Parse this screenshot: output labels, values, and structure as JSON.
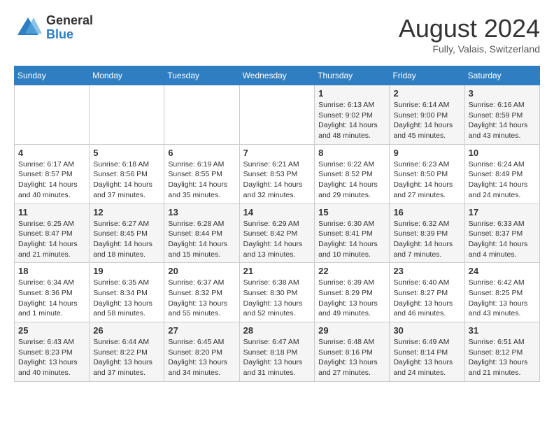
{
  "logo": {
    "general": "General",
    "blue": "Blue"
  },
  "title": "August 2024",
  "location": "Fully, Valais, Switzerland",
  "weekdays": [
    "Sunday",
    "Monday",
    "Tuesday",
    "Wednesday",
    "Thursday",
    "Friday",
    "Saturday"
  ],
  "weeks": [
    [
      {
        "day": "",
        "info": ""
      },
      {
        "day": "",
        "info": ""
      },
      {
        "day": "",
        "info": ""
      },
      {
        "day": "",
        "info": ""
      },
      {
        "day": "1",
        "info": "Sunrise: 6:13 AM\nSunset: 9:02 PM\nDaylight: 14 hours and 48 minutes."
      },
      {
        "day": "2",
        "info": "Sunrise: 6:14 AM\nSunset: 9:00 PM\nDaylight: 14 hours and 45 minutes."
      },
      {
        "day": "3",
        "info": "Sunrise: 6:16 AM\nSunset: 8:59 PM\nDaylight: 14 hours and 43 minutes."
      }
    ],
    [
      {
        "day": "4",
        "info": "Sunrise: 6:17 AM\nSunset: 8:57 PM\nDaylight: 14 hours and 40 minutes."
      },
      {
        "day": "5",
        "info": "Sunrise: 6:18 AM\nSunset: 8:56 PM\nDaylight: 14 hours and 37 minutes."
      },
      {
        "day": "6",
        "info": "Sunrise: 6:19 AM\nSunset: 8:55 PM\nDaylight: 14 hours and 35 minutes."
      },
      {
        "day": "7",
        "info": "Sunrise: 6:21 AM\nSunset: 8:53 PM\nDaylight: 14 hours and 32 minutes."
      },
      {
        "day": "8",
        "info": "Sunrise: 6:22 AM\nSunset: 8:52 PM\nDaylight: 14 hours and 29 minutes."
      },
      {
        "day": "9",
        "info": "Sunrise: 6:23 AM\nSunset: 8:50 PM\nDaylight: 14 hours and 27 minutes."
      },
      {
        "day": "10",
        "info": "Sunrise: 6:24 AM\nSunset: 8:49 PM\nDaylight: 14 hours and 24 minutes."
      }
    ],
    [
      {
        "day": "11",
        "info": "Sunrise: 6:25 AM\nSunset: 8:47 PM\nDaylight: 14 hours and 21 minutes."
      },
      {
        "day": "12",
        "info": "Sunrise: 6:27 AM\nSunset: 8:45 PM\nDaylight: 14 hours and 18 minutes."
      },
      {
        "day": "13",
        "info": "Sunrise: 6:28 AM\nSunset: 8:44 PM\nDaylight: 14 hours and 15 minutes."
      },
      {
        "day": "14",
        "info": "Sunrise: 6:29 AM\nSunset: 8:42 PM\nDaylight: 14 hours and 13 minutes."
      },
      {
        "day": "15",
        "info": "Sunrise: 6:30 AM\nSunset: 8:41 PM\nDaylight: 14 hours and 10 minutes."
      },
      {
        "day": "16",
        "info": "Sunrise: 6:32 AM\nSunset: 8:39 PM\nDaylight: 14 hours and 7 minutes."
      },
      {
        "day": "17",
        "info": "Sunrise: 6:33 AM\nSunset: 8:37 PM\nDaylight: 14 hours and 4 minutes."
      }
    ],
    [
      {
        "day": "18",
        "info": "Sunrise: 6:34 AM\nSunset: 8:36 PM\nDaylight: 14 hours and 1 minute."
      },
      {
        "day": "19",
        "info": "Sunrise: 6:35 AM\nSunset: 8:34 PM\nDaylight: 13 hours and 58 minutes."
      },
      {
        "day": "20",
        "info": "Sunrise: 6:37 AM\nSunset: 8:32 PM\nDaylight: 13 hours and 55 minutes."
      },
      {
        "day": "21",
        "info": "Sunrise: 6:38 AM\nSunset: 8:30 PM\nDaylight: 13 hours and 52 minutes."
      },
      {
        "day": "22",
        "info": "Sunrise: 6:39 AM\nSunset: 8:29 PM\nDaylight: 13 hours and 49 minutes."
      },
      {
        "day": "23",
        "info": "Sunrise: 6:40 AM\nSunset: 8:27 PM\nDaylight: 13 hours and 46 minutes."
      },
      {
        "day": "24",
        "info": "Sunrise: 6:42 AM\nSunset: 8:25 PM\nDaylight: 13 hours and 43 minutes."
      }
    ],
    [
      {
        "day": "25",
        "info": "Sunrise: 6:43 AM\nSunset: 8:23 PM\nDaylight: 13 hours and 40 minutes."
      },
      {
        "day": "26",
        "info": "Sunrise: 6:44 AM\nSunset: 8:22 PM\nDaylight: 13 hours and 37 minutes."
      },
      {
        "day": "27",
        "info": "Sunrise: 6:45 AM\nSunset: 8:20 PM\nDaylight: 13 hours and 34 minutes."
      },
      {
        "day": "28",
        "info": "Sunrise: 6:47 AM\nSunset: 8:18 PM\nDaylight: 13 hours and 31 minutes."
      },
      {
        "day": "29",
        "info": "Sunrise: 6:48 AM\nSunset: 8:16 PM\nDaylight: 13 hours and 27 minutes."
      },
      {
        "day": "30",
        "info": "Sunrise: 6:49 AM\nSunset: 8:14 PM\nDaylight: 13 hours and 24 minutes."
      },
      {
        "day": "31",
        "info": "Sunrise: 6:51 AM\nSunset: 8:12 PM\nDaylight: 13 hours and 21 minutes."
      }
    ]
  ]
}
